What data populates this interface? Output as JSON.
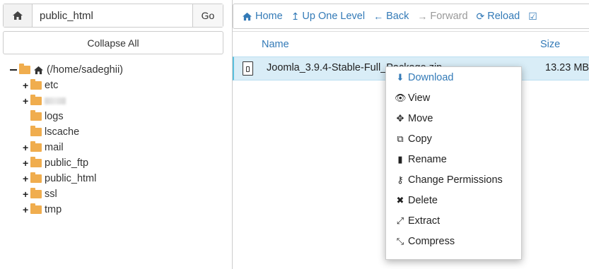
{
  "path_bar": {
    "value": "public_html",
    "go_label": "Go"
  },
  "collapse_label": "Collapse All",
  "tree": {
    "root": "(/home/sadeghii)",
    "items": [
      {
        "label": "etc",
        "expandable": true
      },
      {
        "label": "",
        "expandable": true,
        "blurred": true
      },
      {
        "label": "logs",
        "expandable": false
      },
      {
        "label": "lscache",
        "expandable": false
      },
      {
        "label": "mail",
        "expandable": true
      },
      {
        "label": "public_ftp",
        "expandable": true
      },
      {
        "label": "public_html",
        "expandable": true
      },
      {
        "label": "ssl",
        "expandable": true
      },
      {
        "label": "tmp",
        "expandable": true
      }
    ]
  },
  "toolbar": {
    "home": "Home",
    "up": "Up One Level",
    "back": "Back",
    "forward": "Forward",
    "reload": "Reload"
  },
  "table": {
    "headers": {
      "name": "Name",
      "size": "Size"
    },
    "row": {
      "name": "Joomla_3.9.4-Stable-Full_Package.zip",
      "size": "13.23 MB"
    }
  },
  "context_menu": [
    {
      "label": "Download",
      "icon": "download-icon"
    },
    {
      "label": "View",
      "icon": "eye-icon"
    },
    {
      "label": "Move",
      "icon": "move-icon"
    },
    {
      "label": "Copy",
      "icon": "copy-icon"
    },
    {
      "label": "Rename",
      "icon": "file-icon"
    },
    {
      "label": "Change Permissions",
      "icon": "key-icon"
    },
    {
      "label": "Delete",
      "icon": "x-icon"
    },
    {
      "label": "Extract",
      "icon": "expand-icon"
    },
    {
      "label": "Compress",
      "icon": "compress-icon"
    }
  ],
  "colors": {
    "link": "#337ab7",
    "selected_row": "#d9edf7",
    "folder": "#f0ad4e"
  }
}
